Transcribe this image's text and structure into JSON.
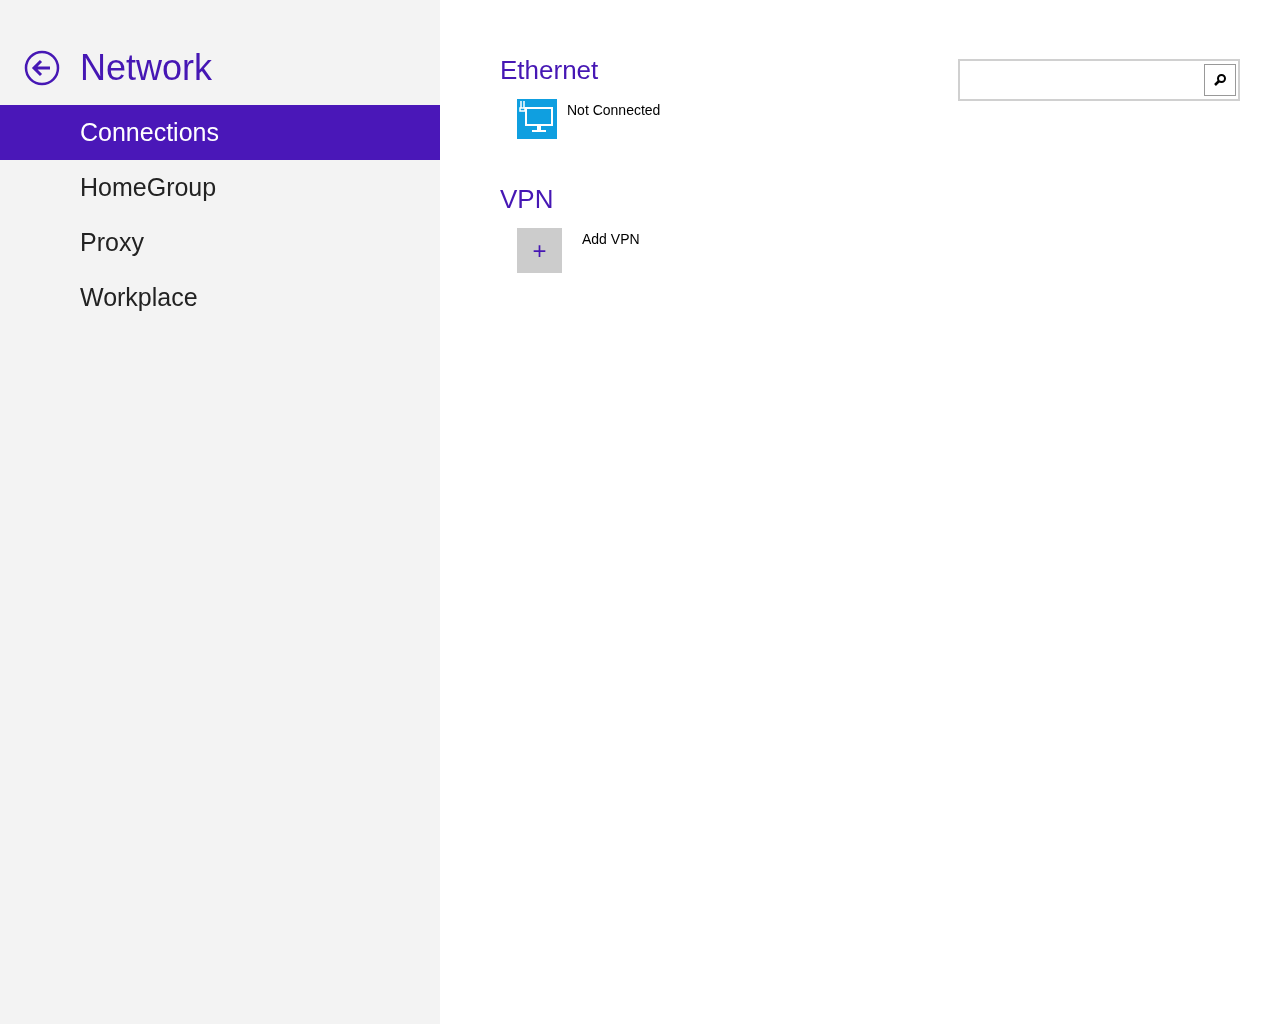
{
  "sidebar": {
    "title": "Network",
    "items": [
      {
        "label": "Connections",
        "selected": true
      },
      {
        "label": "HomeGroup",
        "selected": false
      },
      {
        "label": "Proxy",
        "selected": false
      },
      {
        "label": "Workplace",
        "selected": false
      }
    ]
  },
  "sections": [
    {
      "heading": "Ethernet",
      "items": [
        {
          "kind": "ethernet",
          "label": "Not Connected"
        }
      ]
    },
    {
      "heading": "VPN",
      "items": [
        {
          "kind": "add",
          "label": "Add VPN",
          "icon_text": "+"
        }
      ]
    }
  ]
}
